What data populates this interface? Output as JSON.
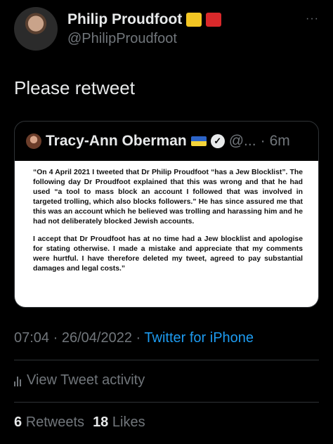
{
  "author": {
    "display_name": "Philip Proudfoot",
    "handle": "@PhilipProudfoot"
  },
  "more_label": "···",
  "tweet": {
    "text": "Please retweet"
  },
  "quote": {
    "name": "Tracy-Ann Oberman",
    "handle": "@...",
    "separator": "·",
    "time": "6m",
    "statement": {
      "p1": "“On 4 April 2021 I tweeted that Dr Philip Proudfoot “has a Jew Blocklist”. The following day Dr Proudfoot explained that this was wrong and that he had used “a tool to mass block an account I followed that was involved in targeted trolling, which also blocks followers.” He has since assured me that this was an account which he believed was trolling and harassing him and he had not deliberately blocked Jewish accounts.",
      "p2": "I accept that Dr Proudfoot has at no time had a Jew blocklist and apologise for stating otherwise. I made a mistake and appreciate that my comments were hurtful. I have therefore deleted my tweet, agreed to pay substantial damages and legal costs.”"
    }
  },
  "meta": {
    "time": "07:04",
    "dot1": "·",
    "date": "26/04/2022",
    "dot2": "·",
    "source": "Twitter for iPhone"
  },
  "activity": {
    "label": "View Tweet activity"
  },
  "counts": {
    "retweets_value": "6",
    "retweets_label": "Retweets",
    "likes_value": "18",
    "likes_label": "Likes"
  }
}
